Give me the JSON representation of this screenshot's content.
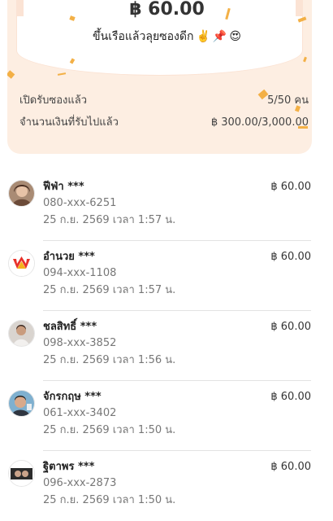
{
  "header": {
    "amount": "฿ 60.00",
    "blessing_text": "ขึ้นเรือแล้วลุยซองดีก",
    "blessing_emojis": [
      "✌️",
      "📌",
      "😍"
    ]
  },
  "stats": {
    "opened_label": "เปิดรับซองแล้ว",
    "opened_value": "5/50 คน",
    "received_label": "จำนวนเงินที่รับไปแล้ว",
    "received_value": "฿ 300.00/3,000.00"
  },
  "recipients": [
    {
      "name": "ฟีฟ่า ***",
      "phone": "080-xxx-6251",
      "time": "25 ก.ย. 2569 เวลา 1:57 น.",
      "amount": "฿ 60.00",
      "avatar": "photo-avatar"
    },
    {
      "name": "อำนวย ***",
      "phone": "094-xxx-1108",
      "time": "25 ก.ย. 2569 เวลา 1:57 น.",
      "amount": "฿ 60.00",
      "avatar": "logo-avatar"
    },
    {
      "name": "ชลสิทธิ์ ***",
      "phone": "098-xxx-3852",
      "time": "25 ก.ย. 2569 เวลา 1:56 น.",
      "amount": "฿ 60.00",
      "avatar": "photo-avatar"
    },
    {
      "name": "จักรกฤษ ***",
      "phone": "061-xxx-3402",
      "time": "25 ก.ย. 2569 เวลา 1:50 น.",
      "amount": "฿ 60.00",
      "avatar": "photo-avatar"
    },
    {
      "name": "ฐิตาพร ***",
      "phone": "096-xxx-2873",
      "time": "25 ก.ย. 2569 เวลา 1:50 น.",
      "amount": "฿ 60.00",
      "avatar": "photo-avatar"
    }
  ],
  "colors": {
    "card_bg": "#fdeee2",
    "confetti": "#f3b046",
    "divider": "#e3e3e3"
  }
}
